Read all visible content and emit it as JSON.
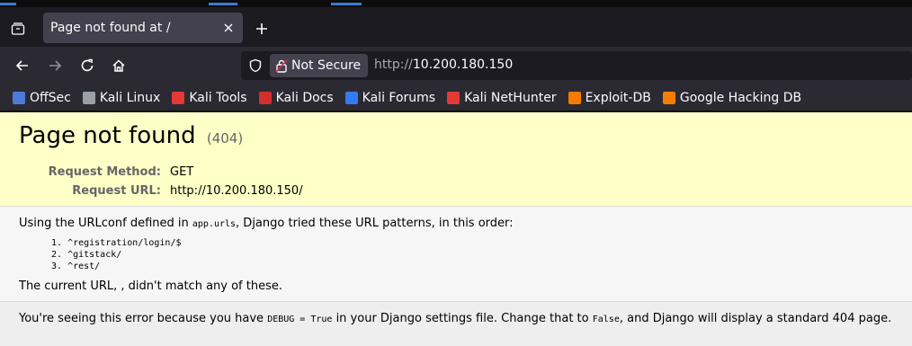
{
  "browser": {
    "tab": {
      "title": "Page not found at /",
      "close_icon": "close-icon"
    },
    "navigation": {
      "back_icon": "arrow-left-icon",
      "forward_icon": "arrow-right-icon",
      "reload_icon": "reload-icon",
      "home_icon": "home-icon"
    },
    "urlbar": {
      "security_label": "Not Secure",
      "url_scheme": "http://",
      "url_host": "10.200.180.150"
    },
    "bookmarks": [
      {
        "label": "OffSec",
        "icon": "offsec-icon",
        "color": "#4b7bd6"
      },
      {
        "label": "Kali Linux",
        "icon": "kali-dragon-icon",
        "color": "#9aa0a6"
      },
      {
        "label": "Kali Tools",
        "icon": "kali-tools-icon",
        "color": "#e53935"
      },
      {
        "label": "Kali Docs",
        "icon": "kali-docs-icon",
        "color": "#d32f2f"
      },
      {
        "label": "Kali Forums",
        "icon": "kali-forums-icon",
        "color": "#367bf0"
      },
      {
        "label": "Kali NetHunter",
        "icon": "nethunter-icon",
        "color": "#e53935"
      },
      {
        "label": "Exploit-DB",
        "icon": "exploit-db-icon",
        "color": "#f57c00"
      },
      {
        "label": "Google Hacking DB",
        "icon": "ghdb-icon",
        "color": "#f57c00"
      }
    ]
  },
  "page": {
    "title": "Page not found",
    "code": "(404)",
    "request_method_label": "Request Method:",
    "request_method_value": "GET",
    "request_url_label": "Request URL:",
    "request_url_value": "http://10.200.180.150/",
    "urlconf_intro_before": "Using the URLconf defined in ",
    "urlconf_module": "app.urls",
    "urlconf_intro_after": ", Django tried these URL patterns, in this order:",
    "patterns": [
      "^registration/login/$",
      "^gitstack/",
      "^rest/"
    ],
    "current_url_text": "The current URL, , didn't match any of these.",
    "explanation_1": "You're seeing this error because you have ",
    "explanation_debug": "DEBUG = True",
    "explanation_2": " in your Django settings file. Change that to ",
    "explanation_false": "False",
    "explanation_3": ", and Django will display a standard 404 page."
  }
}
